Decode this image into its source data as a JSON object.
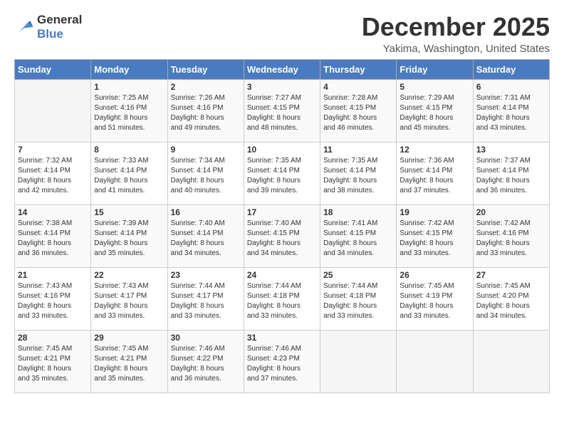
{
  "logo": {
    "line1": "General",
    "line2": "Blue"
  },
  "title": "December 2025",
  "location": "Yakima, Washington, United States",
  "days_of_week": [
    "Sunday",
    "Monday",
    "Tuesday",
    "Wednesday",
    "Thursday",
    "Friday",
    "Saturday"
  ],
  "weeks": [
    [
      {
        "num": "",
        "info": ""
      },
      {
        "num": "1",
        "info": "Sunrise: 7:25 AM\nSunset: 4:16 PM\nDaylight: 8 hours\nand 51 minutes."
      },
      {
        "num": "2",
        "info": "Sunrise: 7:26 AM\nSunset: 4:16 PM\nDaylight: 8 hours\nand 49 minutes."
      },
      {
        "num": "3",
        "info": "Sunrise: 7:27 AM\nSunset: 4:15 PM\nDaylight: 8 hours\nand 48 minutes."
      },
      {
        "num": "4",
        "info": "Sunrise: 7:28 AM\nSunset: 4:15 PM\nDaylight: 8 hours\nand 46 minutes."
      },
      {
        "num": "5",
        "info": "Sunrise: 7:29 AM\nSunset: 4:15 PM\nDaylight: 8 hours\nand 45 minutes."
      },
      {
        "num": "6",
        "info": "Sunrise: 7:31 AM\nSunset: 4:14 PM\nDaylight: 8 hours\nand 43 minutes."
      }
    ],
    [
      {
        "num": "7",
        "info": "Sunrise: 7:32 AM\nSunset: 4:14 PM\nDaylight: 8 hours\nand 42 minutes."
      },
      {
        "num": "8",
        "info": "Sunrise: 7:33 AM\nSunset: 4:14 PM\nDaylight: 8 hours\nand 41 minutes."
      },
      {
        "num": "9",
        "info": "Sunrise: 7:34 AM\nSunset: 4:14 PM\nDaylight: 8 hours\nand 40 minutes."
      },
      {
        "num": "10",
        "info": "Sunrise: 7:35 AM\nSunset: 4:14 PM\nDaylight: 8 hours\nand 39 minutes."
      },
      {
        "num": "11",
        "info": "Sunrise: 7:35 AM\nSunset: 4:14 PM\nDaylight: 8 hours\nand 38 minutes."
      },
      {
        "num": "12",
        "info": "Sunrise: 7:36 AM\nSunset: 4:14 PM\nDaylight: 8 hours\nand 37 minutes."
      },
      {
        "num": "13",
        "info": "Sunrise: 7:37 AM\nSunset: 4:14 PM\nDaylight: 8 hours\nand 36 minutes."
      }
    ],
    [
      {
        "num": "14",
        "info": "Sunrise: 7:38 AM\nSunset: 4:14 PM\nDaylight: 8 hours\nand 36 minutes."
      },
      {
        "num": "15",
        "info": "Sunrise: 7:39 AM\nSunset: 4:14 PM\nDaylight: 8 hours\nand 35 minutes."
      },
      {
        "num": "16",
        "info": "Sunrise: 7:40 AM\nSunset: 4:14 PM\nDaylight: 8 hours\nand 34 minutes."
      },
      {
        "num": "17",
        "info": "Sunrise: 7:40 AM\nSunset: 4:15 PM\nDaylight: 8 hours\nand 34 minutes."
      },
      {
        "num": "18",
        "info": "Sunrise: 7:41 AM\nSunset: 4:15 PM\nDaylight: 8 hours\nand 34 minutes."
      },
      {
        "num": "19",
        "info": "Sunrise: 7:42 AM\nSunset: 4:15 PM\nDaylight: 8 hours\nand 33 minutes."
      },
      {
        "num": "20",
        "info": "Sunrise: 7:42 AM\nSunset: 4:16 PM\nDaylight: 8 hours\nand 33 minutes."
      }
    ],
    [
      {
        "num": "21",
        "info": "Sunrise: 7:43 AM\nSunset: 4:16 PM\nDaylight: 8 hours\nand 33 minutes."
      },
      {
        "num": "22",
        "info": "Sunrise: 7:43 AM\nSunset: 4:17 PM\nDaylight: 8 hours\nand 33 minutes."
      },
      {
        "num": "23",
        "info": "Sunrise: 7:44 AM\nSunset: 4:17 PM\nDaylight: 8 hours\nand 33 minutes."
      },
      {
        "num": "24",
        "info": "Sunrise: 7:44 AM\nSunset: 4:18 PM\nDaylight: 8 hours\nand 33 minutes."
      },
      {
        "num": "25",
        "info": "Sunrise: 7:44 AM\nSunset: 4:18 PM\nDaylight: 8 hours\nand 33 minutes."
      },
      {
        "num": "26",
        "info": "Sunrise: 7:45 AM\nSunset: 4:19 PM\nDaylight: 8 hours\nand 33 minutes."
      },
      {
        "num": "27",
        "info": "Sunrise: 7:45 AM\nSunset: 4:20 PM\nDaylight: 8 hours\nand 34 minutes."
      }
    ],
    [
      {
        "num": "28",
        "info": "Sunrise: 7:45 AM\nSunset: 4:21 PM\nDaylight: 8 hours\nand 35 minutes."
      },
      {
        "num": "29",
        "info": "Sunrise: 7:45 AM\nSunset: 4:21 PM\nDaylight: 8 hours\nand 35 minutes."
      },
      {
        "num": "30",
        "info": "Sunrise: 7:46 AM\nSunset: 4:22 PM\nDaylight: 8 hours\nand 36 minutes."
      },
      {
        "num": "31",
        "info": "Sunrise: 7:46 AM\nSunset: 4:23 PM\nDaylight: 8 hours\nand 37 minutes."
      },
      {
        "num": "",
        "info": ""
      },
      {
        "num": "",
        "info": ""
      },
      {
        "num": "",
        "info": ""
      }
    ]
  ]
}
